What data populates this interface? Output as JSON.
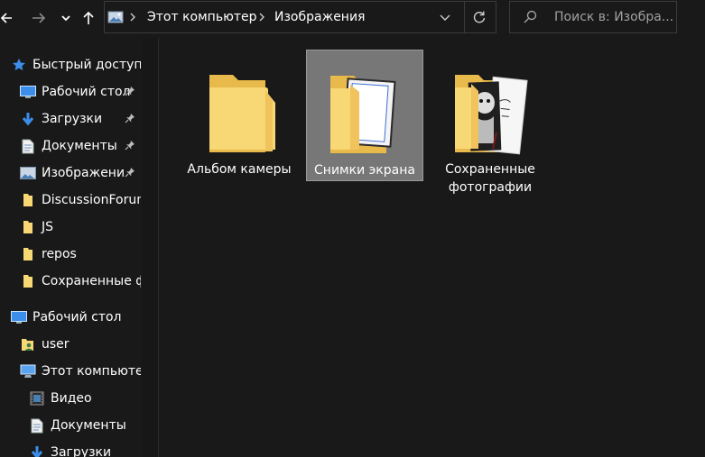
{
  "toolbar": {
    "back_icon": "arrow-left-icon",
    "forward_icon": "arrow-right-icon",
    "recent_icon": "chevron-down-icon",
    "up_icon": "arrow-up-icon",
    "breadcrumb": [
      "Этот компьютер",
      "Изображения"
    ],
    "search_placeholder": "Поиск в: Изобра..."
  },
  "nav": {
    "items": [
      {
        "label": "Быстрый доступ",
        "icon": "star-icon",
        "pinned": false
      },
      {
        "label": "Рабочий стол",
        "icon": "desktop-icon",
        "pinned": true
      },
      {
        "label": "Загрузки",
        "icon": "download-icon",
        "pinned": true
      },
      {
        "label": "Документы",
        "icon": "document-icon",
        "pinned": true
      },
      {
        "label": "Изображени",
        "icon": "pictures-icon",
        "pinned": true
      },
      {
        "label": "DiscussionForum",
        "icon": "folder-icon",
        "pinned": false
      },
      {
        "label": "JS",
        "icon": "folder-icon",
        "pinned": false
      },
      {
        "label": "repos",
        "icon": "folder-icon",
        "pinned": false
      },
      {
        "label": "Сохраненные ф",
        "icon": "folder-icon",
        "pinned": false
      },
      {
        "label": "Рабочий стол",
        "icon": "desktop-icon",
        "pinned": false
      },
      {
        "label": "user",
        "icon": "user-folder-icon",
        "pinned": false
      },
      {
        "label": "Этот компьютер",
        "icon": "computer-icon",
        "pinned": false
      },
      {
        "label": "Видео",
        "icon": "video-icon",
        "pinned": false
      },
      {
        "label": "Документы",
        "icon": "document-icon",
        "pinned": false
      },
      {
        "label": "Загрузки",
        "icon": "download-icon",
        "pinned": false
      }
    ]
  },
  "folders": [
    {
      "label": "Альбом камеры",
      "selected": false,
      "preview": "empty"
    },
    {
      "label": "Снимки экрана",
      "selected": true,
      "preview": "screenshots"
    },
    {
      "label": "Сохраненные фотографии",
      "label_line1": "Сохраненные",
      "label_line2": "фотографии",
      "selected": false,
      "preview": "photos"
    }
  ],
  "colors": {
    "background": "#191919",
    "selection": "#777777",
    "folder": "#f8d775",
    "folder_back": "#e8b94b",
    "accent_blue": "#3b8eea"
  }
}
